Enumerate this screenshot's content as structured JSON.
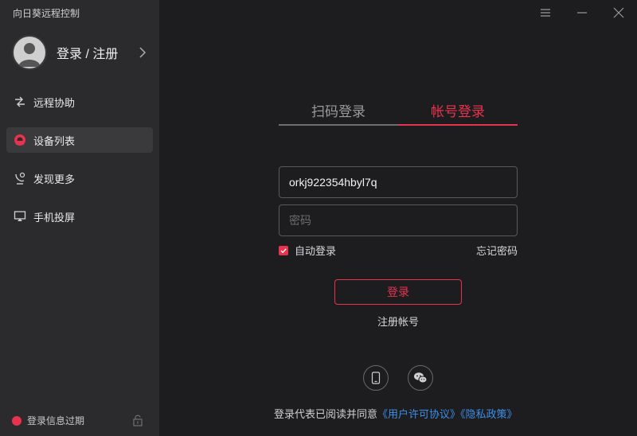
{
  "app": {
    "title": "向日葵远程控制"
  },
  "user": {
    "label": "登录 / 注册"
  },
  "nav": {
    "items": [
      {
        "label": "远程协助",
        "icon": "remote-assist-icon"
      },
      {
        "label": "设备列表",
        "icon": "device-list-icon"
      },
      {
        "label": "发现更多",
        "icon": "discover-icon"
      },
      {
        "label": "手机投屏",
        "icon": "screen-cast-icon"
      }
    ],
    "active_index": 1
  },
  "status": {
    "text": "登录信息过期",
    "dot_color": "#e8334f"
  },
  "login": {
    "tabs": [
      {
        "label": "扫码登录"
      },
      {
        "label": "帐号登录"
      }
    ],
    "active_tab": 1,
    "account_value": "orkj922354hbyl7q",
    "password_placeholder": "密码",
    "remember_label": "自动登录",
    "remember_checked": true,
    "forgot_label": "忘记密码",
    "login_button": "登录",
    "register_label": "注册帐号"
  },
  "agreement": {
    "prefix": "登录代表已阅读并同意",
    "user_agreement": "《用户许可协议》",
    "privacy_policy": "《隐私政策》"
  },
  "colors": {
    "accent": "#e8334f",
    "link": "#3d8ee8",
    "sidebar_bg": "#2b2b2d",
    "main_bg": "#1d1d1f"
  }
}
